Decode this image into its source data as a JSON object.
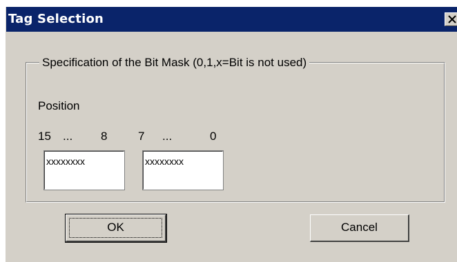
{
  "window": {
    "title": "Tag Selection"
  },
  "group": {
    "legend": "Specification of the Bit Mask (0,1,x=Bit is not used)",
    "position_label": "Position",
    "high_byte": {
      "range_start": "15",
      "range_ellipsis": "...",
      "range_end": "8",
      "value": "xxxxxxxx"
    },
    "low_byte": {
      "range_start": "7",
      "range_ellipsis": "...",
      "range_end": "0",
      "value": "xxxxxxxx"
    }
  },
  "buttons": {
    "ok_label": "OK",
    "cancel_label": "Cancel"
  },
  "icons": {
    "close": "close-icon"
  },
  "colors": {
    "titlebar": "#0a246a",
    "dialog_face": "#d4d0c8",
    "title_text": "#ffffff"
  }
}
